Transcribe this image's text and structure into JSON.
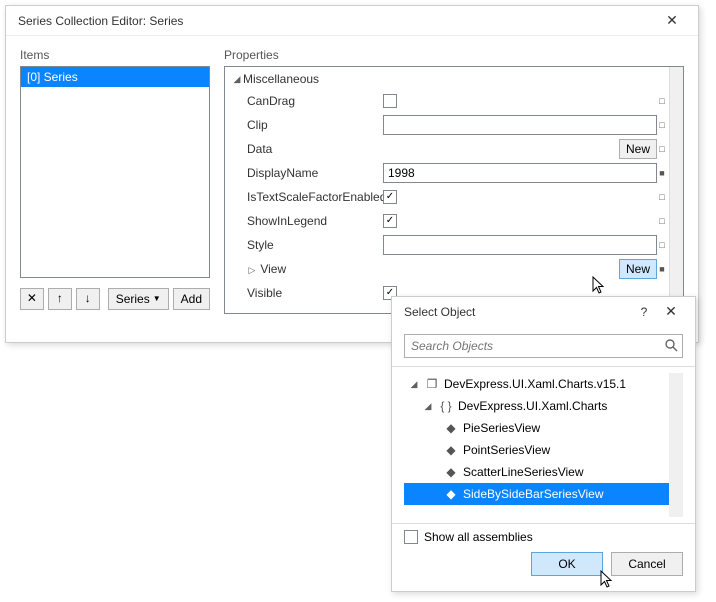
{
  "main": {
    "title": "Series Collection Editor: Series",
    "items_label": "Items",
    "properties_label": "Properties",
    "items": [
      {
        "label": "[0] Series"
      }
    ],
    "toolbar": {
      "delete": "✕",
      "up": "↑",
      "down": "↓",
      "type_dropdown": "Series",
      "add": "Add"
    },
    "category_label": "Miscellaneous",
    "props": {
      "canDrag": {
        "name": "CanDrag",
        "checked": false,
        "marker": "□"
      },
      "clip": {
        "name": "Clip",
        "value": "",
        "marker": "□"
      },
      "data": {
        "name": "Data",
        "button": "New",
        "marker": "□"
      },
      "displayName": {
        "name": "DisplayName",
        "value": "1998",
        "marker": "■"
      },
      "isTextScale": {
        "name": "IsTextScaleFactorEnabled",
        "checked": true,
        "marker": "□"
      },
      "showInLegend": {
        "name": "ShowInLegend",
        "checked": true,
        "marker": "□"
      },
      "style": {
        "name": "Style",
        "value": "",
        "marker": "□"
      },
      "view": {
        "name": "View",
        "button": "New",
        "marker": "■"
      },
      "visible": {
        "name": "Visible",
        "checked": true
      }
    }
  },
  "sub": {
    "title": "Select Object",
    "search_placeholder": "Search Objects",
    "tree": {
      "assembly": "DevExpress.UI.Xaml.Charts.v15.1",
      "namespace": "DevExpress.UI.Xaml.Charts",
      "types": [
        {
          "label": "PieSeriesView"
        },
        {
          "label": "PointSeriesView"
        },
        {
          "label": "ScatterLineSeriesView"
        },
        {
          "label": "SideBySideBarSeriesView",
          "selected": true
        }
      ]
    },
    "show_all_label": "Show all assemblies",
    "show_all_checked": false,
    "ok": "OK",
    "cancel": "Cancel"
  }
}
